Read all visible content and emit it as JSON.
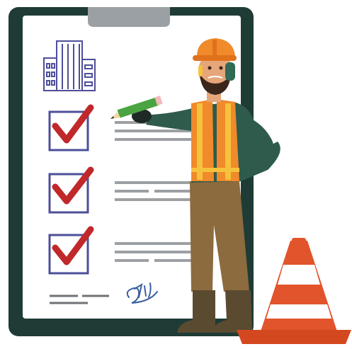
{
  "illustration": {
    "subject": "",
    "checklist": {
      "items": [
        {
          "checked": true
        },
        {
          "checked": true
        },
        {
          "checked": true
        }
      ]
    },
    "colors": {
      "clipboard_frame": "#1f3b36",
      "paper": "#ffffff",
      "clip": "#9aa0a4",
      "building": "#4d4f9a",
      "checkbox_border": "#4d4f9a",
      "checkmark": "#c0282a",
      "text_lines": "#9da0a3",
      "helmet": "#f08a2a",
      "vest": "#f08a2a",
      "vest_stripes": "#f6c23c",
      "shirt": "#2e5b4c",
      "pants": "#8c6b3e",
      "boots": "#5a4a30",
      "skin": "#e5a67a",
      "beard": "#3b261b",
      "pencil": "#4aa441",
      "cone": "#e2542b",
      "cone_stripe": "#ffffff",
      "signature": "#3b5fa0"
    },
    "icons": [
      "building-icon",
      "checkbox-icon",
      "checkmark-icon",
      "pencil-icon",
      "signature-icon",
      "traffic-cone-icon",
      "hard-hat-icon"
    ]
  }
}
